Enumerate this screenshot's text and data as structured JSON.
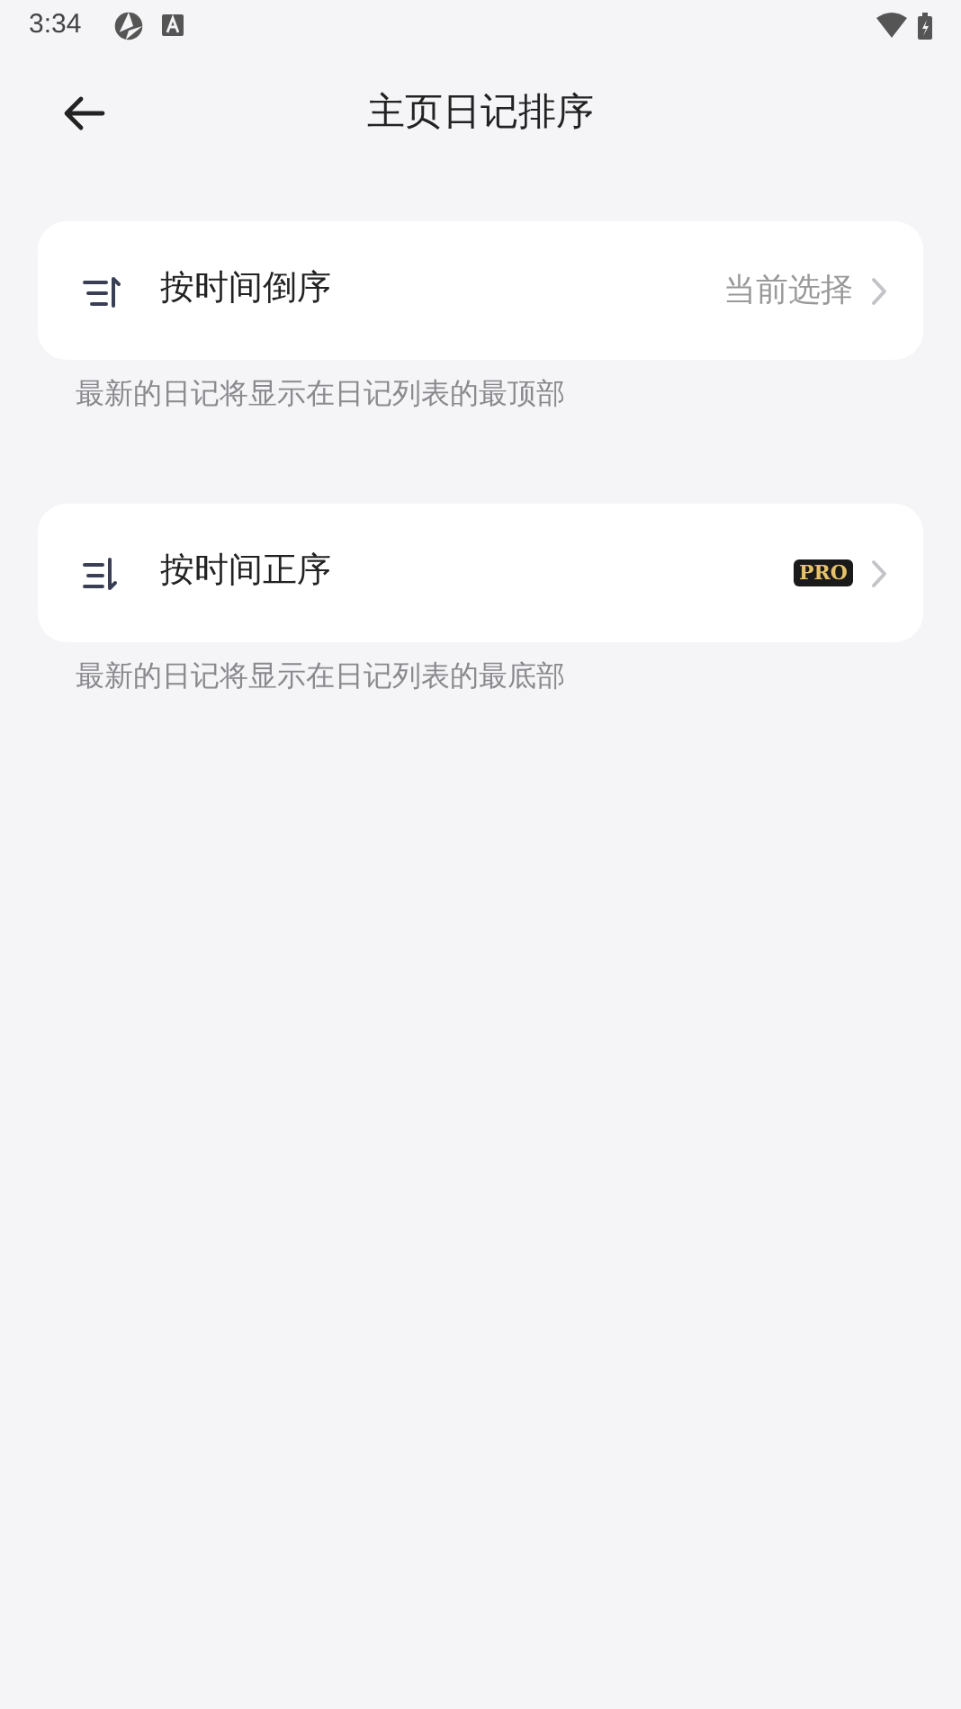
{
  "status_bar": {
    "time": "3:34"
  },
  "header": {
    "title": "主页日记排序"
  },
  "options": [
    {
      "kind": "descending",
      "label": "按时间倒序",
      "status": "当前选择",
      "description": "最新的日记将显示在日记列表的最顶部"
    },
    {
      "kind": "ascending",
      "label": "按时间正序",
      "badge": "PRO",
      "description": "最新的日记将显示在日记列表的最底部"
    }
  ]
}
